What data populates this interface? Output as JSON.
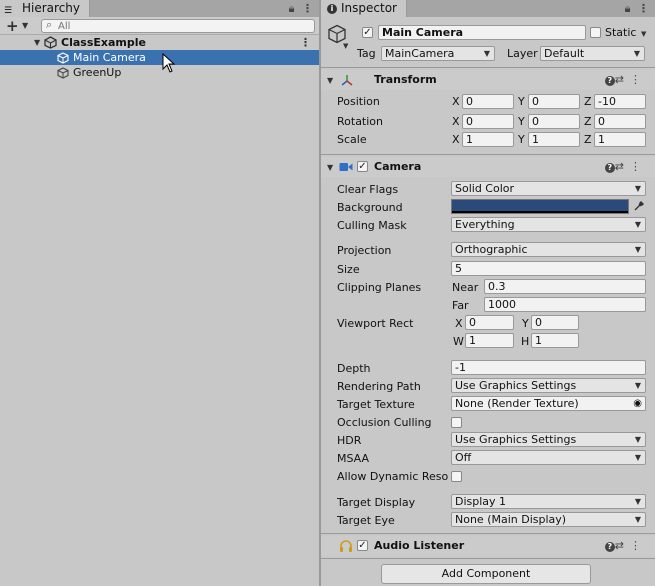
{
  "hierarchy": {
    "tab_label": "Hierarchy",
    "search_placeholder": "All",
    "scene_name": "ClassExample",
    "objects": [
      "Main Camera",
      "GreenUp"
    ],
    "selected_index": 0
  },
  "inspector": {
    "tab_label": "Inspector",
    "object_name": "Main Camera",
    "static_label": "Static",
    "tag_label": "Tag",
    "tag_value": "MainCamera",
    "layer_label": "Layer",
    "layer_value": "Default",
    "transform": {
      "title": "Transform",
      "rows": [
        {
          "label": "Position",
          "x": "0",
          "y": "0",
          "z": "-10"
        },
        {
          "label": "Rotation",
          "x": "0",
          "y": "0",
          "z": "0"
        },
        {
          "label": "Scale",
          "x": "1",
          "y": "1",
          "z": "1"
        }
      ]
    },
    "camera": {
      "title": "Camera",
      "clear_flags_label": "Clear Flags",
      "clear_flags_value": "Solid Color",
      "background_label": "Background",
      "background_color": "#2a4a7a",
      "culling_mask_label": "Culling Mask",
      "culling_mask_value": "Everything",
      "projection_label": "Projection",
      "projection_value": "Orthographic",
      "size_label": "Size",
      "size_value": "5",
      "clipping_label": "Clipping Planes",
      "near_label": "Near",
      "near_value": "0.3",
      "far_label": "Far",
      "far_value": "1000",
      "viewport_label": "Viewport Rect",
      "vp_x": "0",
      "vp_y": "0",
      "vp_w": "1",
      "vp_h": "1",
      "depth_label": "Depth",
      "depth_value": "-1",
      "rendering_path_label": "Rendering Path",
      "rendering_path_value": "Use Graphics Settings",
      "target_texture_label": "Target Texture",
      "target_texture_value": "None (Render Texture)",
      "occlusion_label": "Occlusion Culling",
      "hdr_label": "HDR",
      "hdr_value": "Use Graphics Settings",
      "msaa_label": "MSAA",
      "msaa_value": "Off",
      "dynres_label": "Allow Dynamic Resolu",
      "target_display_label": "Target Display",
      "target_display_value": "Display 1",
      "target_eye_label": "Target Eye",
      "target_eye_value": "None (Main Display)"
    },
    "audio_listener_title": "Audio Listener",
    "add_component_label": "Add Component"
  },
  "axes": {
    "x": "X",
    "y": "Y",
    "z": "Z",
    "w": "W",
    "h": "H"
  }
}
